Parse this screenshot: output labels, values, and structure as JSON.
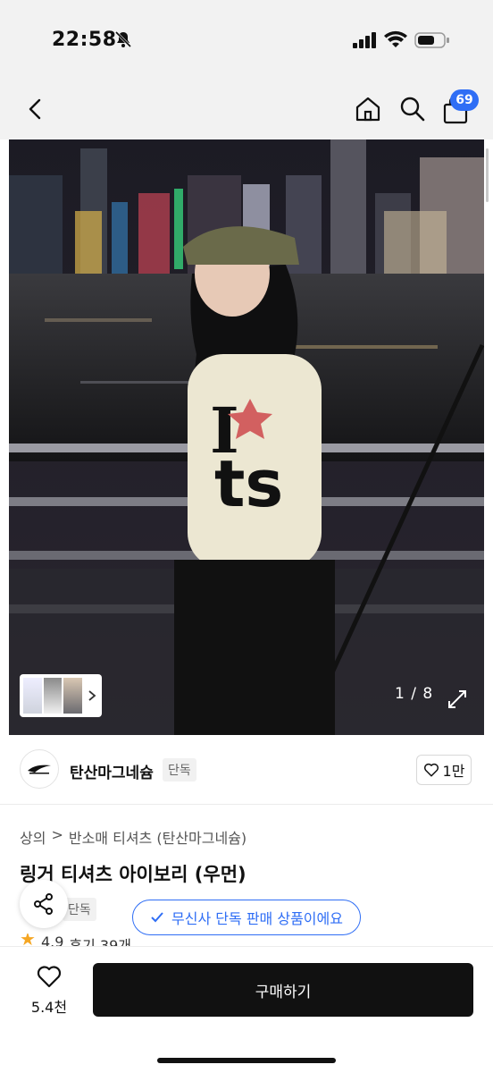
{
  "status": {
    "time": "22:58",
    "bell_icon": "bell-off-icon",
    "signal_icon": "signal-icon",
    "wifi_icon": "wifi-icon",
    "battery_icon": "battery-icon"
  },
  "nav": {
    "back_icon": "chevron-left-icon",
    "home_icon": "home-icon",
    "search_icon": "search-icon",
    "bag_icon": "shopping-bag-icon",
    "cart_count": "69"
  },
  "gallery": {
    "page_indicator": "1 / 8",
    "expand_icon": "expand-icon",
    "thumb_chevron_icon": "chevron-right-icon"
  },
  "brand": {
    "name": "탄산마그네슘",
    "exclusive_tag": "단독",
    "like_count": "1만",
    "like_icon": "heart-icon"
  },
  "breadcrumb": {
    "category": "상의",
    "separator": ">",
    "subcategory": "반소매 티셔츠 (탄산마그네슘)"
  },
  "product": {
    "title": "링거 티셔츠 아이보리 (우먼)",
    "tag": "단독",
    "rating": "4.9",
    "reviews": "후기 39개"
  },
  "toast": {
    "text": "무신사 단독 판매 상품이에요",
    "icon": "check-icon"
  },
  "share": {
    "icon": "share-icon"
  },
  "bottom": {
    "wish_count": "5.4천",
    "wish_icon": "heart-icon",
    "buy_label": "구매하기"
  },
  "colors": {
    "accent": "#2f6ef5",
    "buy_button": "#111111",
    "star": "#f5a623"
  }
}
